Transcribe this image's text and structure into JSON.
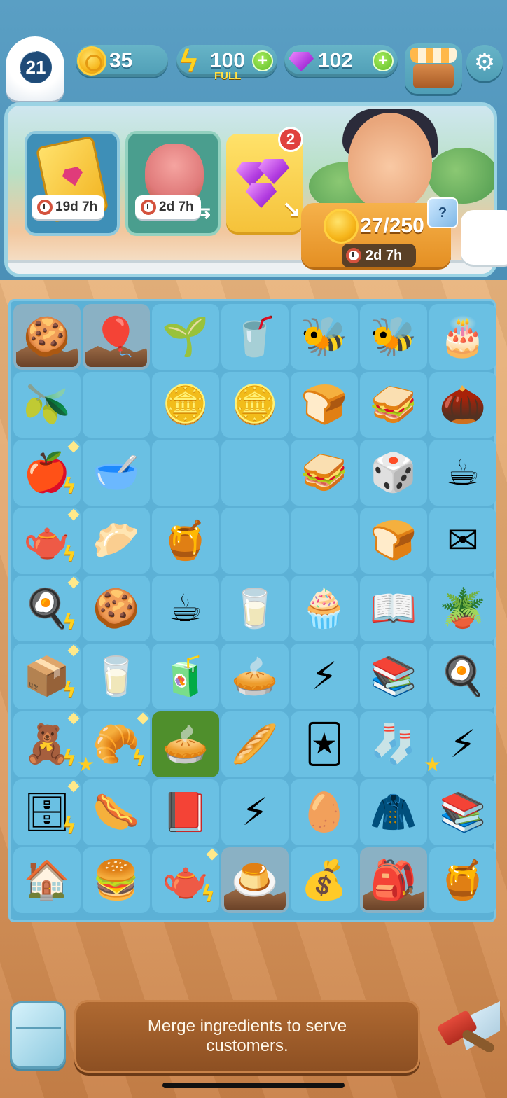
{
  "hud": {
    "level": "21",
    "coins": "35",
    "energy": "100",
    "energy_status": "FULL",
    "gems": "102",
    "plus": "+"
  },
  "icons": {
    "settings": "⚙",
    "refresh": "⇆",
    "arrow": "↘",
    "energy_generator": "ϟ",
    "star": "★"
  },
  "panel": {
    "season_pass_timer": "19d 7h",
    "pet_event_timer": "2d 7h",
    "gem_offer_badge": "2",
    "order_progress": "27/250",
    "order_timer": "2d 7h",
    "mystery_box_mark": "?"
  },
  "board": {
    "rows": [
      [
        {
          "name": "starfish-cookie",
          "icon": "🍪",
          "state": "locked"
        },
        {
          "name": "pink-star-balloon",
          "icon": "🎈",
          "state": "locked"
        },
        {
          "name": "green-sprout",
          "icon": "🌱"
        },
        {
          "name": "green-smoothie",
          "icon": "🥤"
        },
        {
          "name": "bee",
          "icon": "🐝"
        },
        {
          "name": "bee-swarm",
          "icon": "🐝"
        },
        {
          "name": "chocolate-cake",
          "icon": "🎂"
        }
      ],
      [
        {
          "name": "olives-bowl",
          "icon": "🫒"
        },
        {
          "name": "empty",
          "icon": ""
        },
        {
          "name": "two-coins",
          "icon": "🪙"
        },
        {
          "name": "coin-stack",
          "icon": "🪙"
        },
        {
          "name": "toast",
          "icon": "🍞"
        },
        {
          "name": "toast-sandwich",
          "icon": "🥪"
        },
        {
          "name": "cocoa-bean",
          "icon": "🌰"
        }
      ],
      [
        {
          "name": "apple-crate-generator",
          "icon": "🍎",
          "generator": true
        },
        {
          "name": "cream-bowl",
          "icon": "🥣"
        },
        {
          "name": "empty",
          "icon": ""
        },
        {
          "name": "empty",
          "icon": ""
        },
        {
          "name": "jam-sandwich",
          "icon": "🥪"
        },
        {
          "name": "board-game",
          "icon": "🎲"
        },
        {
          "name": "latte-cup",
          "icon": "☕"
        }
      ],
      [
        {
          "name": "tea-cart-generator",
          "icon": "🫖",
          "generator": true
        },
        {
          "name": "dough-tray",
          "icon": "🥟"
        },
        {
          "name": "honey-jar",
          "icon": "🍯"
        },
        {
          "name": "empty",
          "icon": ""
        },
        {
          "name": "empty",
          "icon": ""
        },
        {
          "name": "bread-loaf",
          "icon": "🍞"
        },
        {
          "name": "letter-shelf",
          "icon": "✉"
        }
      ],
      [
        {
          "name": "green-stove-generator",
          "icon": "🍳",
          "generator": true
        },
        {
          "name": "cookie-plate",
          "icon": "🍪"
        },
        {
          "name": "coffee-mug",
          "icon": "☕"
        },
        {
          "name": "water-glass",
          "icon": "🥛"
        },
        {
          "name": "muffin",
          "icon": "🧁"
        },
        {
          "name": "signed-book",
          "icon": "📖"
        },
        {
          "name": "sprout-pot",
          "icon": "🪴"
        }
      ],
      [
        {
          "name": "grocery-box-generator",
          "icon": "📦",
          "generator": true
        },
        {
          "name": "small-glass",
          "icon": "🥛"
        },
        {
          "name": "orange-juice",
          "icon": "🧃"
        },
        {
          "name": "pie",
          "icon": "🥧"
        },
        {
          "name": "energy-bolts",
          "icon": "⚡"
        },
        {
          "name": "book-stack",
          "icon": "📚"
        },
        {
          "name": "lime-stove",
          "icon": "🍳"
        }
      ],
      [
        {
          "name": "toy-box-generator",
          "icon": "🧸",
          "generator": true
        },
        {
          "name": "bread-basket",
          "icon": "🥐",
          "generator": true,
          "star": true
        },
        {
          "name": "pie-slice",
          "icon": "🥧",
          "state": "selected"
        },
        {
          "name": "sub-sandwich",
          "icon": "🥖"
        },
        {
          "name": "playing-cards",
          "icon": "🃏"
        },
        {
          "name": "green-socks",
          "icon": "🧦"
        },
        {
          "name": "energy-bolt-pile",
          "icon": "⚡",
          "star": true
        }
      ],
      [
        {
          "name": "bookshelf-generator",
          "icon": "🗄",
          "generator": true
        },
        {
          "name": "hot-dog",
          "icon": "🌭"
        },
        {
          "name": "book-shelf",
          "icon": "📕"
        },
        {
          "name": "energy-bolts-big",
          "icon": "⚡"
        },
        {
          "name": "egg-timer",
          "icon": "🥚"
        },
        {
          "name": "varsity-jacket",
          "icon": "🧥"
        },
        {
          "name": "book-bracket",
          "icon": "📚"
        }
      ],
      [
        {
          "name": "birdhouse",
          "icon": "🏠"
        },
        {
          "name": "burger",
          "icon": "🍔"
        },
        {
          "name": "tea-set-generator",
          "icon": "🫖",
          "generator": true
        },
        {
          "name": "jelly",
          "icon": "🍮",
          "state": "locked"
        },
        {
          "name": "seed-sack",
          "icon": "💰"
        },
        {
          "name": "craft-bag",
          "icon": "🎒",
          "state": "locked"
        },
        {
          "name": "beehive",
          "icon": "🍯"
        }
      ]
    ]
  },
  "hint": {
    "text": "Merge ingredients to serve customers."
  },
  "colors": {
    "sky": "#5a9fc4",
    "board": "#5cb1d6",
    "cell": "#6ac0e3",
    "selected_cell": "#4f8f2c",
    "hint_bg": "#9a5a28",
    "energy_yellow": "#ffd21e"
  }
}
